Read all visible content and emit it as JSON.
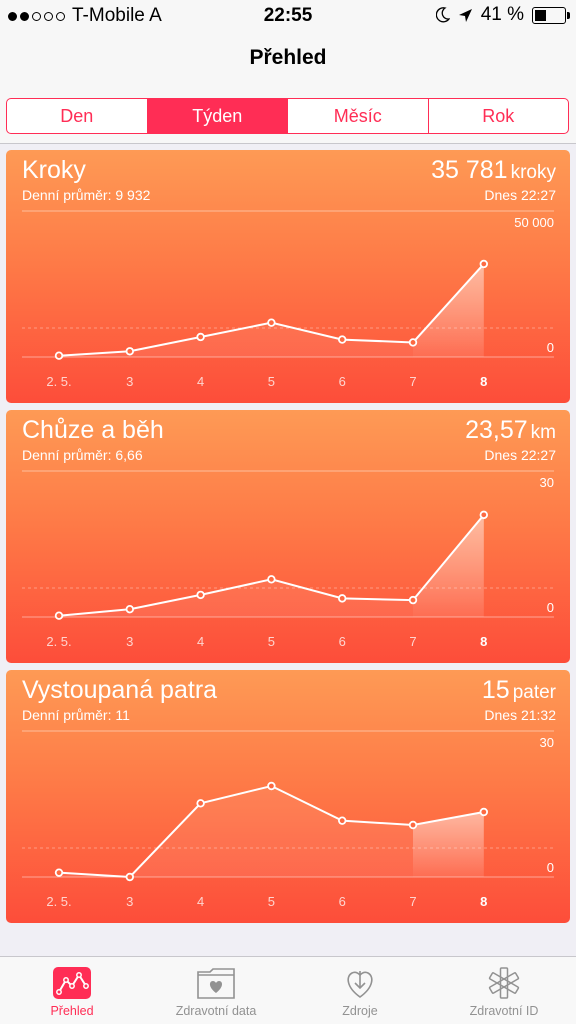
{
  "status_bar": {
    "carrier": "T-Mobile A",
    "time": "22:55",
    "battery": "41 %",
    "battery_level": 0.41
  },
  "nav": {
    "title": "Přehled"
  },
  "segments": [
    {
      "label": "Den",
      "active": false
    },
    {
      "label": "Týden",
      "active": true
    },
    {
      "label": "Měsíc",
      "active": false
    },
    {
      "label": "Rok",
      "active": false
    }
  ],
  "cards": [
    {
      "title": "Kroky",
      "subtitle": "Denní průměr: 9 932",
      "value": "35 781",
      "unit": "kroky",
      "date": "Dnes 22:27",
      "ymax_label": "50 000",
      "ymin_label": "0",
      "ymax": 50000,
      "chart_data": {
        "type": "line",
        "x": [
          "2. 5.",
          "3",
          "4",
          "5",
          "6",
          "7",
          "8"
        ],
        "values": [
          500,
          2200,
          7700,
          13200,
          6700,
          5600,
          35781
        ],
        "ylim": [
          0,
          50000
        ]
      }
    },
    {
      "title": "Chůze a běh",
      "subtitle": "Denní průměr: 6,66",
      "value": "23,57",
      "unit": "km",
      "date": "Dnes 22:27",
      "ymax_label": "30",
      "ymin_label": "0",
      "ymax": 30,
      "chart_data": {
        "type": "line",
        "x": [
          "2. 5.",
          "3",
          "4",
          "5",
          "6",
          "7",
          "8"
        ],
        "values": [
          0.3,
          1.8,
          5.1,
          8.7,
          4.3,
          3.9,
          23.57
        ],
        "ylim": [
          0,
          30
        ]
      }
    },
    {
      "title": "Vystoupaná patra",
      "subtitle": "Denní průměr: 11",
      "value": "15",
      "unit": "pater",
      "date": "Dnes 21:32",
      "ymax_label": "30",
      "ymin_label": "0",
      "ymax": 30,
      "chart_data": {
        "type": "line",
        "x": [
          "2. 5.",
          "3",
          "4",
          "5",
          "6",
          "7",
          "8"
        ],
        "values": [
          1,
          0,
          17,
          21,
          13,
          12,
          15
        ],
        "ylim": [
          0,
          30
        ]
      }
    }
  ],
  "tabs": [
    {
      "label": "Přehled",
      "icon": "overview-chart-icon",
      "active": true
    },
    {
      "label": "Zdravotní data",
      "icon": "health-data-folder-icon",
      "active": false
    },
    {
      "label": "Zdroje",
      "icon": "sources-download-icon",
      "active": false
    },
    {
      "label": "Zdravotní ID",
      "icon": "medical-id-asterisk-icon",
      "active": false
    }
  ]
}
